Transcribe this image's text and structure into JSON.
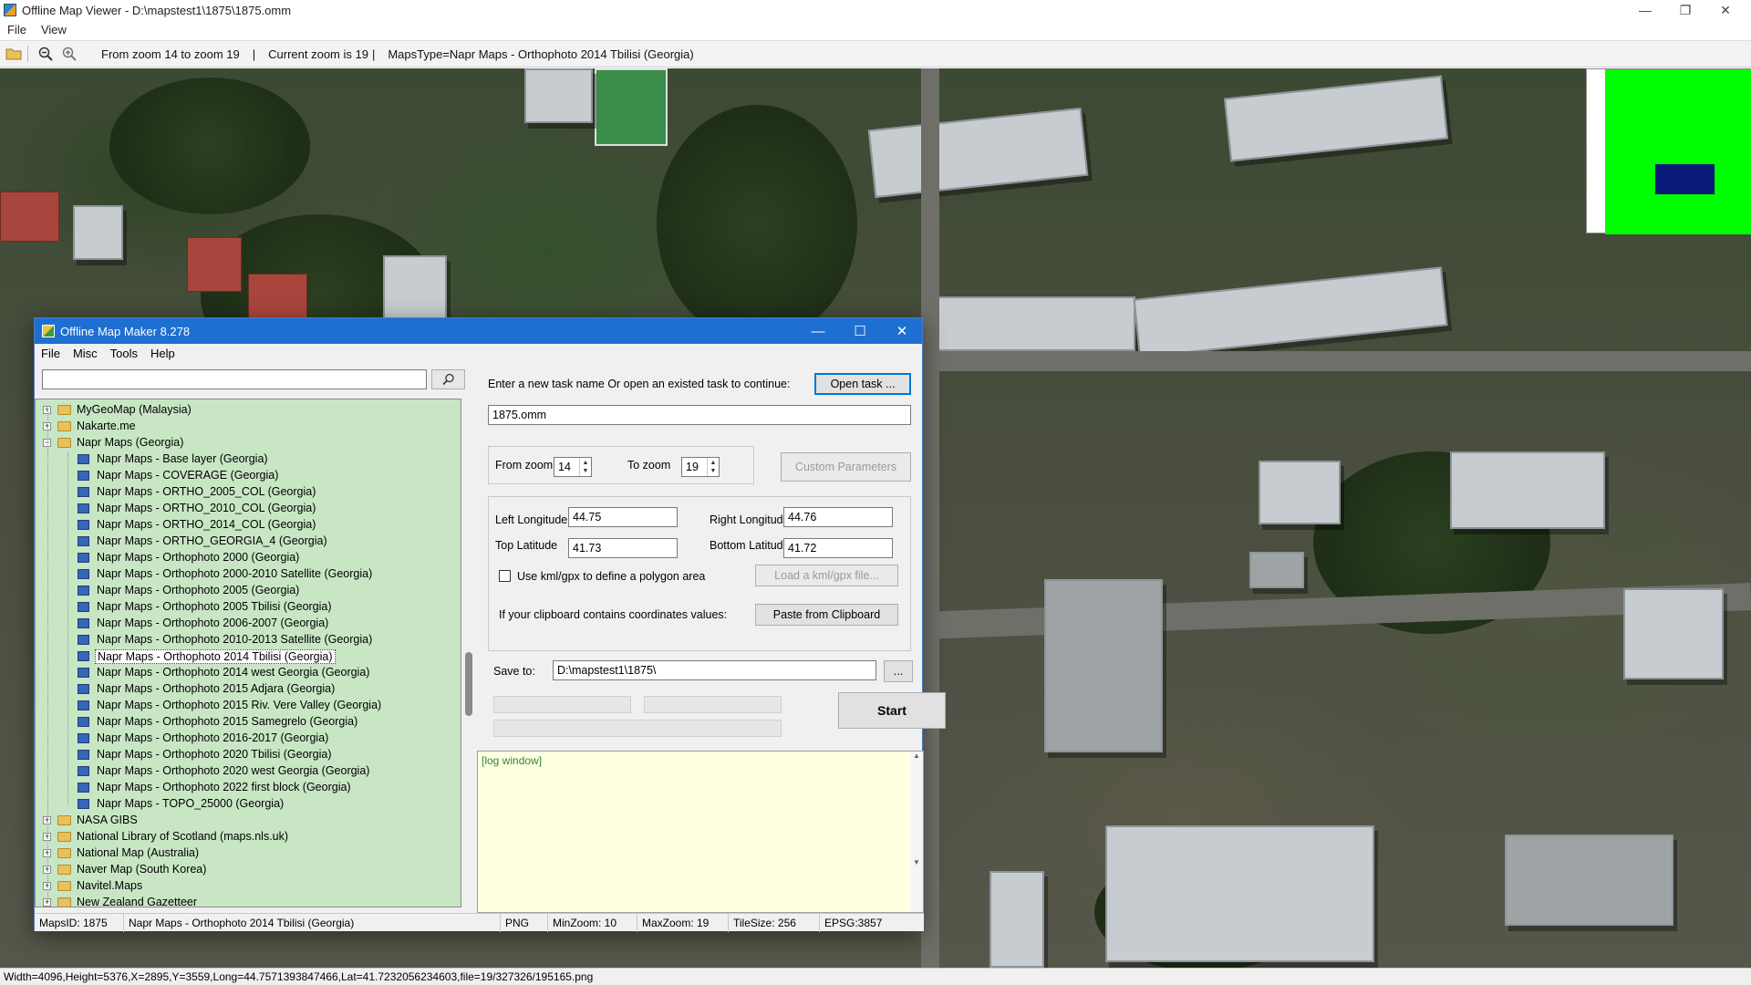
{
  "viewer": {
    "title": "Offline Map Viewer - D:\\mapstest1\\1875\\1875.omm",
    "menu": [
      "File",
      "View"
    ],
    "toolbar": {
      "zoom_range": "From zoom 14 to zoom 19",
      "current_zoom": "Current zoom is 19",
      "maps_type": "MapsType=Napr Maps - Orthophoto 2014 Tbilisi (Georgia)",
      "sep": "|"
    },
    "status": "Width=4096,Height=5376,X=2895,Y=3559,Long=44.7571393847466,Lat=41.7232056234603,file=19/327326/195165.png",
    "minimap_colors": {
      "bg": "#00ff00",
      "viewport": "#0a1a78"
    }
  },
  "dialog": {
    "title": "Offline Map Maker 8.278",
    "menu": [
      "File",
      "Misc",
      "Tools",
      "Help"
    ],
    "search_value": "",
    "tree": {
      "groups_top": [
        {
          "label": "MyGeoMap (Malaysia)",
          "expanded": false
        },
        {
          "label": "Nakarte.me",
          "expanded": false
        },
        {
          "label": "Napr Maps (Georgia)",
          "expanded": true
        }
      ],
      "children": [
        "Napr Maps - Base layer (Georgia)",
        "Napr Maps - COVERAGE (Georgia)",
        "Napr Maps - ORTHO_2005_COL (Georgia)",
        "Napr Maps - ORTHO_2010_COL (Georgia)",
        "Napr Maps - ORTHO_2014_COL (Georgia)",
        "Napr Maps - ORTHO_GEORGIA_4 (Georgia)",
        "Napr Maps - Orthophoto 2000 (Georgia)",
        "Napr Maps - Orthophoto 2000-2010 Satellite (Georgia)",
        "Napr Maps - Orthophoto 2005 (Georgia)",
        "Napr Maps - Orthophoto 2005 Tbilisi (Georgia)",
        "Napr Maps - Orthophoto 2006-2007 (Georgia)",
        "Napr Maps - Orthophoto 2010-2013 Satellite (Georgia)",
        "Napr Maps - Orthophoto 2014 Tbilisi (Georgia)",
        "Napr Maps - Orthophoto 2014 west Georgia (Georgia)",
        "Napr Maps - Orthophoto 2015 Adjara (Georgia)",
        "Napr Maps - Orthophoto 2015 Riv. Vere Valley (Georgia)",
        "Napr Maps - Orthophoto 2015 Samegrelo (Georgia)",
        "Napr Maps - Orthophoto 2016-2017 (Georgia)",
        "Napr Maps - Orthophoto 2020 Tbilisi (Georgia)",
        "Napr Maps - Orthophoto 2020 west Georgia (Georgia)",
        "Napr Maps - Orthophoto 2022 first block (Georgia)",
        "Napr Maps - TOPO_25000 (Georgia)"
      ],
      "selected_child": "Napr Maps - Orthophoto 2014 Tbilisi (Georgia)",
      "groups_bottom": [
        "NASA GIBS",
        "National Library of Scotland (maps.nls.uk)",
        "National Map (Australia)",
        "Naver Map (South Korea)",
        "Navitel.Maps",
        "New Zealand Gazetteer"
      ],
      "bg_color": "#c8e6c4"
    },
    "task_prompt": "Enter a new task name Or open an existed task to continue:",
    "open_task_label": "Open task ...",
    "task_name": "1875.omm",
    "from_zoom_label": "From zoom",
    "from_zoom": "14",
    "to_zoom_label": "To zoom",
    "to_zoom": "19",
    "custom_params_label": "Custom Parameters",
    "left_lon_label": "Left Longitude",
    "left_lon": "44.75",
    "right_lon_label": "Right Longitude",
    "right_lon": "44.76",
    "top_lat_label": "Top Latitude",
    "top_lat": "41.73",
    "bottom_lat_label": "Bottom Latitude",
    "bottom_lat": "41.72",
    "kml_label": "Use kml/gpx to define a polygon area",
    "kml_checked": false,
    "load_kml_label": "Load a kml/gpx file...",
    "clipboard_text": "If your clipboard contains coordinates values:",
    "paste_label": "Paste from Clipboard",
    "save_to_label": "Save to:",
    "save_to": "D:\\mapstest1\\1875\\",
    "browse_label": "...",
    "start_label": "Start",
    "log_text": "[log window]",
    "status": {
      "maps_id": "MapsID: 1875",
      "maps_name": "Napr Maps - Orthophoto 2014 Tbilisi (Georgia)",
      "format": "PNG",
      "min_zoom": "MinZoom: 10",
      "max_zoom": "MaxZoom: 19",
      "tile_size": "TileSize: 256",
      "epsg": "EPSG:3857"
    },
    "accent": "#1e6fd2"
  }
}
